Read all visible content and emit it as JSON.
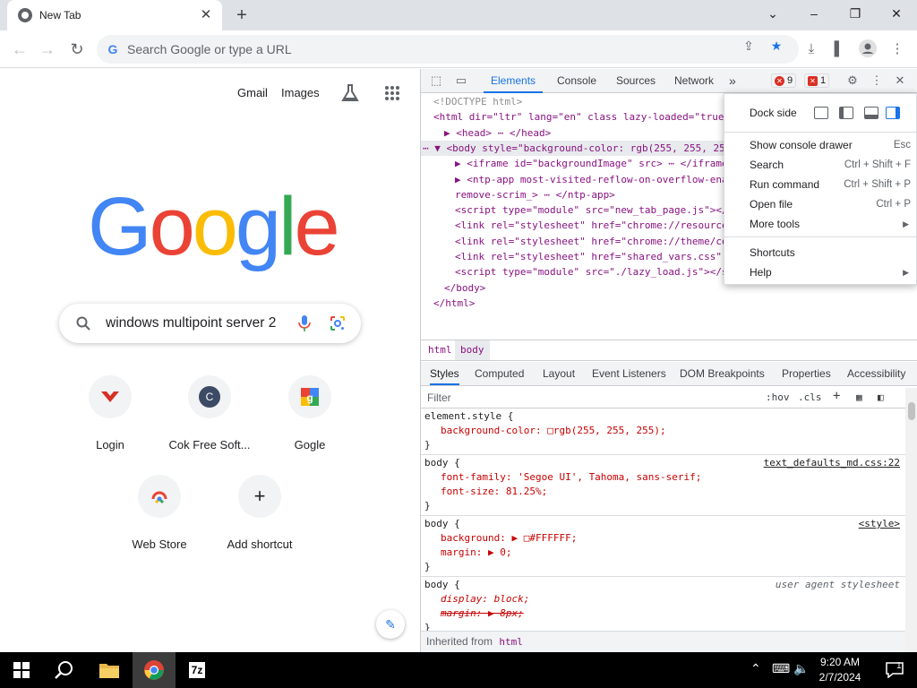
{
  "window": {
    "tab_title": "New Tab",
    "controls": {
      "minimize": "–",
      "restore": "❐",
      "close": "✕",
      "dropdown": "⌄"
    }
  },
  "toolbar": {
    "omnibox_placeholder": "Search Google or type a URL"
  },
  "ntp": {
    "links": {
      "gmail": "Gmail",
      "images": "Images"
    },
    "logo_letters": [
      {
        "char": "G",
        "color": "#4285f4"
      },
      {
        "char": "o",
        "color": "#ea4335"
      },
      {
        "char": "o",
        "color": "#fbbc05"
      },
      {
        "char": "g",
        "color": "#4285f4"
      },
      {
        "char": "l",
        "color": "#34a853"
      },
      {
        "char": "e",
        "color": "#ea4335"
      }
    ],
    "search_query": "windows multipoint server 2",
    "shortcuts": [
      {
        "label": "Login",
        "icon": "login-icon"
      },
      {
        "label": "Cok Free Soft...",
        "icon": "c-letter-icon",
        "letter": "C"
      },
      {
        "label": "Gogle",
        "icon": "gogle-icon"
      },
      {
        "label": "Web Store",
        "icon": "webstore-icon"
      },
      {
        "label": "Add shortcut",
        "icon": "plus-icon",
        "glyph": "+"
      }
    ]
  },
  "devtools": {
    "tabs": [
      "Elements",
      "Console",
      "Sources",
      "Network"
    ],
    "more_tabs": "»",
    "error_count": "9",
    "issue_count": "1",
    "dom_lines": [
      {
        "text": "<!DOCTYPE html>",
        "indent": 0,
        "cls": "cm"
      },
      {
        "text": "<html dir=\"ltr\" lang=\"en\" class lazy-loaded=\"true",
        "indent": 0,
        "cls": "tag"
      },
      {
        "text": "▶ <head> ⋯ </head>",
        "indent": 1,
        "cls": "tag"
      },
      {
        "text": "⋯ ▼ <body style=\"background-color: rgb(255, 255, 25",
        "indent": 0,
        "cls": "tag",
        "selected": true
      },
      {
        "text": "▶ <iframe id=\"backgroundImage\" src> ⋯ </iframe>",
        "indent": 2,
        "cls": "tag"
      },
      {
        "text": "▶ <ntp-app most-visited-reflow-on-overflow-enab",
        "indent": 2,
        "cls": "tag"
      },
      {
        "text": "remove-scrim_> ⋯ </ntp-app>",
        "indent": 2,
        "cls": "tag"
      },
      {
        "text": "<script type=\"module\" src=\"new_tab_page.js\"></",
        "indent": 2,
        "cls": "tag"
      },
      {
        "text": "<link rel=\"stylesheet\" href=\"chrome://resource",
        "indent": 2,
        "cls": "tag"
      },
      {
        "text": "<link rel=\"stylesheet\" href=\"chrome://theme/co",
        "indent": 2,
        "cls": "tag"
      },
      {
        "text": "<link rel=\"stylesheet\" href=\"shared_vars.css\"",
        "indent": 2,
        "cls": "tag"
      },
      {
        "text": "<script type=\"module\" src=\"./lazy_load.js\"></s",
        "indent": 2,
        "cls": "tag"
      },
      {
        "text": "</body>",
        "indent": 1,
        "cls": "tag"
      },
      {
        "text": "</html>",
        "indent": 0,
        "cls": "tag"
      }
    ],
    "breadcrumbs": [
      "html",
      "body"
    ],
    "style_tabs": [
      "Styles",
      "Computed",
      "Layout",
      "Event Listeners",
      "DOM Breakpoints",
      "Properties",
      "Accessibility"
    ],
    "filter_placeholder": "Filter",
    "hov": ":hov",
    "cls": ".cls",
    "rules": [
      {
        "text": "element.style {",
        "kind": "sel"
      },
      {
        "text": "background-color: □rgb(255, 255, 255);",
        "kind": "prop"
      },
      {
        "text": "}",
        "kind": "sel"
      },
      {
        "text": "body {",
        "kind": "sel",
        "source": "text_defaults_md.css:22"
      },
      {
        "text": "font-family: 'Segoe UI', Tahoma, sans-serif;",
        "kind": "prop"
      },
      {
        "text": "font-size: 81.25%;",
        "kind": "prop"
      },
      {
        "text": "}",
        "kind": "sel"
      },
      {
        "text": "body {",
        "kind": "sel",
        "source": "<style>"
      },
      {
        "text": "background: ▶ □#FFFFFF;",
        "kind": "prop"
      },
      {
        "text": "margin: ▶ 0;",
        "kind": "prop"
      },
      {
        "text": "}",
        "kind": "sel"
      },
      {
        "text": "body {",
        "kind": "sel",
        "ua": "user agent stylesheet"
      },
      {
        "text": "display: block;",
        "kind": "uaprop"
      },
      {
        "text": "margin: ▶ 8px;",
        "kind": "strike"
      },
      {
        "text": "}",
        "kind": "sel"
      }
    ],
    "inherited_label": "Inherited from",
    "inherited_tag": "html"
  },
  "menu": {
    "dock_side_label": "Dock side",
    "items": [
      {
        "label": "Show console drawer",
        "shortcut": "Esc"
      },
      {
        "label": "Search",
        "shortcut": "Ctrl + Shift + F"
      },
      {
        "label": "Run command",
        "shortcut": "Ctrl + Shift + P"
      },
      {
        "label": "Open file",
        "shortcut": "Ctrl + P"
      },
      {
        "label": "More tools",
        "submenu": true
      },
      {
        "label": "Shortcuts"
      },
      {
        "label": "Help",
        "submenu": true
      }
    ]
  },
  "taskbar": {
    "time": "9:20 AM",
    "date": "2/7/2024",
    "notifications": "1",
    "apps": [
      "start-icon",
      "search-icon",
      "file-explorer-icon",
      "chrome-icon",
      "7zip-icon"
    ],
    "sevenzip_label": "7z"
  }
}
